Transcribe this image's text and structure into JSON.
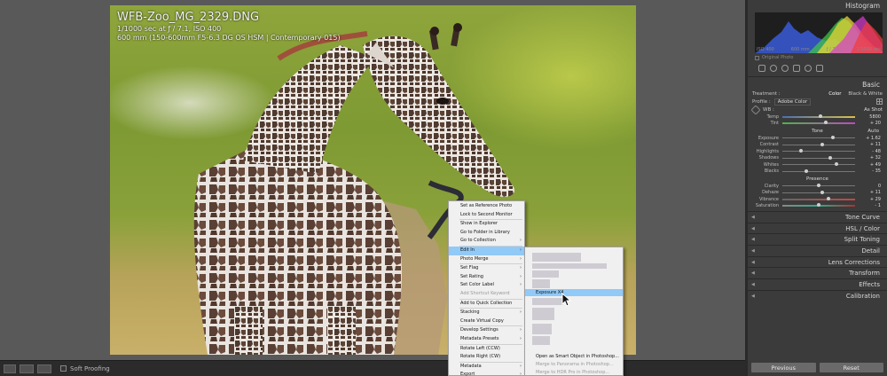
{
  "photo": {
    "filename": "WFB-Zoo_MG_2329.DNG",
    "exposure_line": "1/1000 sec at ƒ / 7.1, ISO 400",
    "lens_line": "600 mm (150-600mm F5-6.3 DG OS HSM | Contemporary 015)"
  },
  "toolbar": {
    "soft_proofing_label": "Soft Proofing"
  },
  "panel": {
    "histogram_title": "Histogram",
    "histogram_readout": [
      "ISO 400",
      "600 mm",
      "ƒ / 7.1",
      "1/1000 sec"
    ],
    "original_photo_label": "Original Photo",
    "basic_title": "Basic",
    "treatment_label": "Treatment :",
    "treatment_color": "Color",
    "treatment_bw": "Black & White",
    "profile_label": "Profile :",
    "profile_value": "Adobe Color",
    "wb_label": "WB :",
    "wb_value": "As Shot",
    "tone_label": "Tone",
    "tone_auto": "Auto",
    "presence_label": "Presence",
    "sliders_wb": [
      {
        "label": "Temp",
        "value": "5800",
        "pos": 0.52,
        "track": "temp"
      },
      {
        "label": "Tint",
        "value": "+ 20",
        "pos": 0.6,
        "track": "tint"
      }
    ],
    "sliders_tone": [
      {
        "label": "Exposure",
        "value": "+ 1.62",
        "pos": 0.7
      },
      {
        "label": "Contrast",
        "value": "+ 11",
        "pos": 0.55
      },
      {
        "label": "Highlights",
        "value": "- 48",
        "pos": 0.26
      },
      {
        "label": "Shadows",
        "value": "+ 32",
        "pos": 0.66
      },
      {
        "label": "Whites",
        "value": "+ 49",
        "pos": 0.74
      },
      {
        "label": "Blacks",
        "value": "- 35",
        "pos": 0.33
      }
    ],
    "sliders_presence": [
      {
        "label": "Clarity",
        "value": "0",
        "pos": 0.5
      },
      {
        "label": "Dehaze",
        "value": "+ 11",
        "pos": 0.55
      },
      {
        "label": "Vibrance",
        "value": "+ 29",
        "pos": 0.64,
        "track": "vib"
      },
      {
        "label": "Saturation",
        "value": "- 1",
        "pos": 0.5,
        "track": "sat"
      }
    ],
    "collapsed_sections": [
      "Tone Curve",
      "HSL / Color",
      "Split Toning",
      "Detail",
      "Lens Corrections",
      "Transform",
      "Effects",
      "Calibration"
    ],
    "previous_label": "Previous",
    "reset_label": "Reset"
  },
  "context_menu": {
    "items": [
      {
        "label": "Set as Reference Photo"
      },
      {
        "label": "Lock to Second Monitor"
      },
      {
        "sep": true
      },
      {
        "label": "Show in Explorer"
      },
      {
        "label": "Go to Folder in Library"
      },
      {
        "label": "Go to Collection",
        "arrow": true
      },
      {
        "sep": true
      },
      {
        "label": "Edit In",
        "arrow": true,
        "hl": true
      },
      {
        "label": "Photo Merge",
        "arrow": true
      },
      {
        "sep": true
      },
      {
        "label": "Set Flag",
        "arrow": true
      },
      {
        "label": "Set Rating",
        "arrow": true
      },
      {
        "label": "Set Color Label",
        "arrow": true
      },
      {
        "label": "Add Shortcut Keyword",
        "disabled": true
      },
      {
        "sep": true
      },
      {
        "label": "Add to Quick Collection"
      },
      {
        "sep": true
      },
      {
        "label": "Stacking",
        "arrow": true
      },
      {
        "label": "Create Virtual Copy"
      },
      {
        "sep": true
      },
      {
        "label": "Develop Settings",
        "arrow": true
      },
      {
        "label": "Metadata Presets",
        "arrow": true
      },
      {
        "sep": true
      },
      {
        "label": "Rotate Left (CCW)"
      },
      {
        "label": "Rotate Right (CW)"
      },
      {
        "sep": true
      },
      {
        "label": "Metadata",
        "arrow": true
      },
      {
        "label": "Export",
        "arrow": true
      }
    ]
  },
  "submenu": {
    "highlighted_item": "Exposure X4",
    "smart_object_item": "Open as Smart Object in Photoshop...",
    "panorama_item": "Merge to Panorama in Photoshop...",
    "hdr_item": "Merge to HDR Pro in Photoshop..."
  },
  "colors": {
    "menu_highlight": "#91c9f7",
    "panel_bg": "#3b3b3b",
    "canvas_bg": "#595959"
  }
}
